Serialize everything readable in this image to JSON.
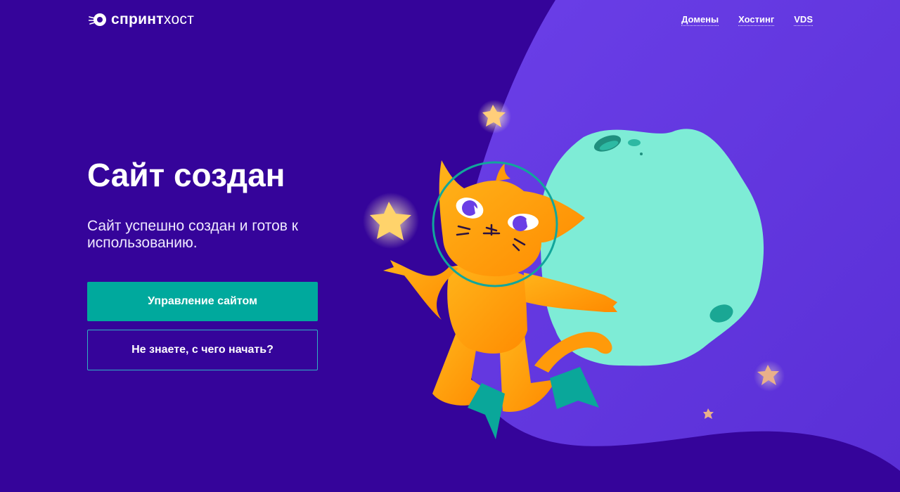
{
  "brand": {
    "logo_strong": "спринт",
    "logo_light": "хост"
  },
  "nav": {
    "items": [
      {
        "label": "Домены"
      },
      {
        "label": "Хостинг"
      },
      {
        "label": "VDS"
      }
    ]
  },
  "hero": {
    "title": "Сайт создан",
    "subtitle": "Сайт успешно создан и готов к использованию."
  },
  "buttons": {
    "primary": "Управление сайтом",
    "secondary": "Не знаете, с чего начать?"
  },
  "colors": {
    "background": "#35049a",
    "accent_panel": "#6a3ee6",
    "button_primary": "#00a99d",
    "planet": "#7eecd6",
    "cat": "#ff9a0a"
  },
  "icons": {
    "logo": "rocket-logo-icon",
    "illustration": "astronaut-cat-illustration"
  }
}
